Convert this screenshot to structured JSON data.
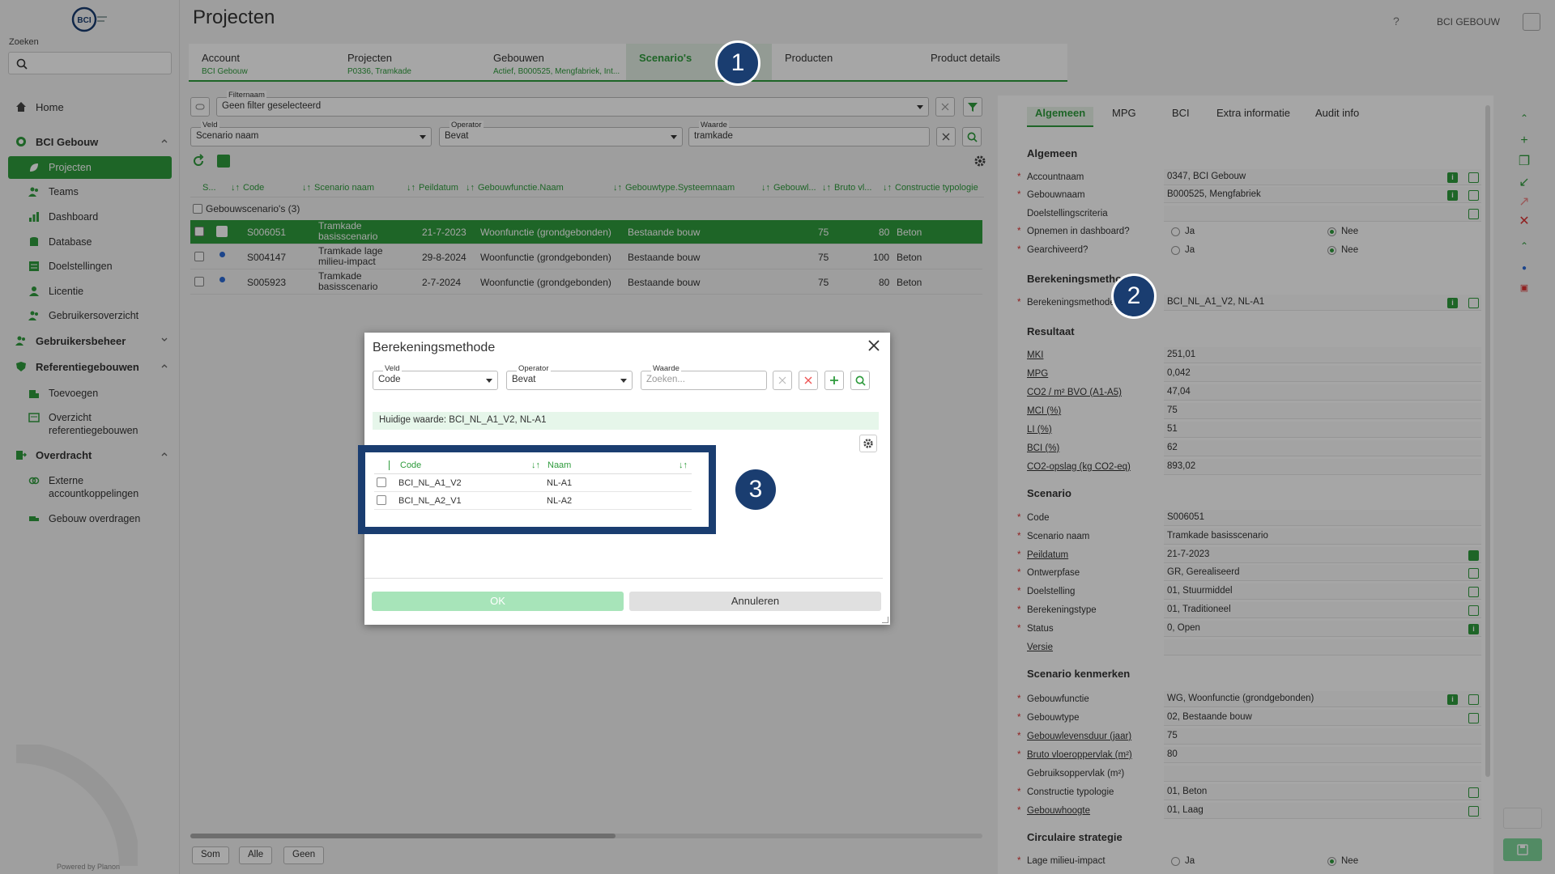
{
  "sidebar": {
    "logo_text": "BCI",
    "search_label": "Zoeken",
    "items": [
      {
        "label": "Home"
      },
      {
        "label": "BCI Gebouw"
      },
      {
        "label": "Projecten"
      },
      {
        "label": "Teams"
      },
      {
        "label": "Dashboard"
      },
      {
        "label": "Database"
      },
      {
        "label": "Doelstellingen"
      },
      {
        "label": "Licentie"
      },
      {
        "label": "Gebruikersoverzicht"
      },
      {
        "label": "Gebruikersbeheer"
      },
      {
        "label": "Referentiegebouwen"
      },
      {
        "label": "Toevoegen"
      },
      {
        "label": "Overzicht referentiegebouwen"
      },
      {
        "label": "Overdracht"
      },
      {
        "label": "Externe accountkoppelingen"
      },
      {
        "label": "Gebouw overdragen"
      }
    ],
    "powered_by": "Powered by Planon"
  },
  "header": {
    "title": "Projecten",
    "help": "?",
    "user": "BCI GEBOUW"
  },
  "tabs": [
    {
      "label": "Account",
      "sub": "BCI Gebouw"
    },
    {
      "label": "Projecten",
      "sub": "P0336, Tramkade"
    },
    {
      "label": "Gebouwen",
      "sub": "Actief, B000525, Mengfabriek, Int..."
    },
    {
      "label": "Scenario's",
      "sub": ""
    },
    {
      "label": "Producten",
      "sub": ""
    },
    {
      "label": "Product details",
      "sub": ""
    }
  ],
  "badges": {
    "one": "1",
    "two": "2",
    "three": "3"
  },
  "filter": {
    "filter_label": "Filternaam",
    "filter_value": "Geen filter geselecteerd",
    "veld_label": "Veld",
    "veld_value": "Scenario naam",
    "operator_label": "Operator",
    "operator_value": "Bevat",
    "waarde_label": "Waarde",
    "waarde_value": "tramkade"
  },
  "grid": {
    "headers": [
      "S...",
      "Code",
      "Scenario naam",
      "Peildatum",
      "Gebouwfunctie.Naam",
      "Gebouwtype.Systeemnaam",
      "Gebouwl...",
      "Bruto vl...",
      "Constructie typologie"
    ],
    "group": "Gebouwscenario's (3)",
    "rows": [
      {
        "code": "S006051",
        "naam": "Tramkade basisscenario",
        "peildatum": "21-7-2023",
        "functie": "Woonfunctie (grondgebonden)",
        "type": "Bestaande bouw",
        "levensduur": "75",
        "bruto": "80",
        "constructie": "Beton"
      },
      {
        "code": "S004147",
        "naam": "Tramkade lage milieu-impact",
        "peildatum": "29-8-2024",
        "functie": "Woonfunctie (grondgebonden)",
        "type": "Bestaande bouw",
        "levensduur": "75",
        "bruto": "100",
        "constructie": "Beton"
      },
      {
        "code": "S005923",
        "naam": "Tramkade basisscenario",
        "peildatum": "2-7-2024",
        "functie": "Woonfunctie (grondgebonden)",
        "type": "Bestaande bouw",
        "levensduur": "75",
        "bruto": "80",
        "constructie": "Beton"
      }
    ],
    "footer": [
      "Som",
      "Alle",
      "Geen"
    ]
  },
  "details": {
    "tabs": [
      "Algemeen",
      "MPG",
      "BCI",
      "Extra informatie",
      "Audit info"
    ],
    "sections": {
      "algemeen": "Algemeen",
      "berekeningsmethode": "Berekeningsmethode",
      "resultaat": "Resultaat",
      "scenario": "Scenario",
      "kenmerken": "Scenario kenmerken",
      "circulair": "Circulaire strategie"
    },
    "fields": {
      "accountnaam": {
        "label": "Accountnaam",
        "value": "0347, BCI Gebouw"
      },
      "gebouwnaam": {
        "label": "Gebouwnaam",
        "value": "B000525, Mengfabriek"
      },
      "doelstellingscriteria": {
        "label": "Doelstellingscriteria",
        "value": ""
      },
      "opnemen": {
        "label": "Opnemen in dashboard?",
        "ja": "Ja",
        "nee": "Nee"
      },
      "gearchiveerd": {
        "label": "Gearchiveerd?",
        "ja": "Ja",
        "nee": "Nee"
      },
      "berekeningsmethode": {
        "label": "Berekeningsmethode",
        "value": "BCI_NL_A1_V2, NL-A1"
      },
      "mki": {
        "label": "MKI",
        "value": "251,01"
      },
      "mpg": {
        "label": "MPG",
        "value": "0,042"
      },
      "co2": {
        "label": "CO2 / m² BVO (A1-A5)",
        "value": "47,04"
      },
      "mci": {
        "label": "MCI (%)",
        "value": "75"
      },
      "li": {
        "label": "LI (%)",
        "value": "51"
      },
      "bci": {
        "label": "BCI (%)",
        "value": "62"
      },
      "co2opslag": {
        "label": "CO2-opslag (kg CO2-eq)",
        "value": "893,02"
      },
      "code": {
        "label": "Code",
        "value": "S006051"
      },
      "scenarionaam": {
        "label": "Scenario naam",
        "value": "Tramkade basisscenario"
      },
      "peildatum": {
        "label": "Peildatum",
        "value": "21-7-2023"
      },
      "ontwerpfase": {
        "label": "Ontwerpfase",
        "value": "GR, Gerealiseerd"
      },
      "doelstelling": {
        "label": "Doelstelling",
        "value": "01, Stuurmiddel"
      },
      "berekeningstype": {
        "label": "Berekeningstype",
        "value": "01, Traditioneel"
      },
      "status": {
        "label": "Status",
        "value": "0, Open"
      },
      "versie": {
        "label": "Versie",
        "value": ""
      },
      "gebouwfunctie": {
        "label": "Gebouwfunctie",
        "value": "WG, Woonfunctie (grondgebonden)"
      },
      "gebouwtype": {
        "label": "Gebouwtype",
        "value": "02, Bestaande bouw"
      },
      "levensduur": {
        "label": "Gebouwlevensduur (jaar)",
        "value": "75"
      },
      "bruto": {
        "label": "Bruto vloeroppervlak (m²)",
        "value": "80"
      },
      "gebruiksoppervlak": {
        "label": "Gebruiksoppervlak (m²)",
        "value": ""
      },
      "constructie": {
        "label": "Constructie typologie",
        "value": "01, Beton"
      },
      "gebouwhoogte": {
        "label": "Gebouwhoogte",
        "value": "01, Laag"
      },
      "lage": {
        "label": "Lage milieu-impact",
        "ja": "Ja",
        "nee": "Nee"
      }
    }
  },
  "modal": {
    "title": "Berekeningsmethode",
    "veld_label": "Veld",
    "veld_value": "Code",
    "operator_label": "Operator",
    "operator_value": "Bevat",
    "waarde_label": "Waarde",
    "waarde_placeholder": "Zoeken...",
    "current": "Huidige waarde: BCI_NL_A1_V2, NL-A1",
    "headers": [
      "Code",
      "Naam"
    ],
    "rows": [
      {
        "code": "BCI_NL_A1_V2",
        "naam": "NL-A1"
      },
      {
        "code": "BCI_NL_A2_V1",
        "naam": "NL-A2"
      }
    ],
    "ok": "OK",
    "cancel": "Annuleren"
  },
  "colors": {
    "accent": "#2e9b3c",
    "badge": "#1a3d70"
  }
}
